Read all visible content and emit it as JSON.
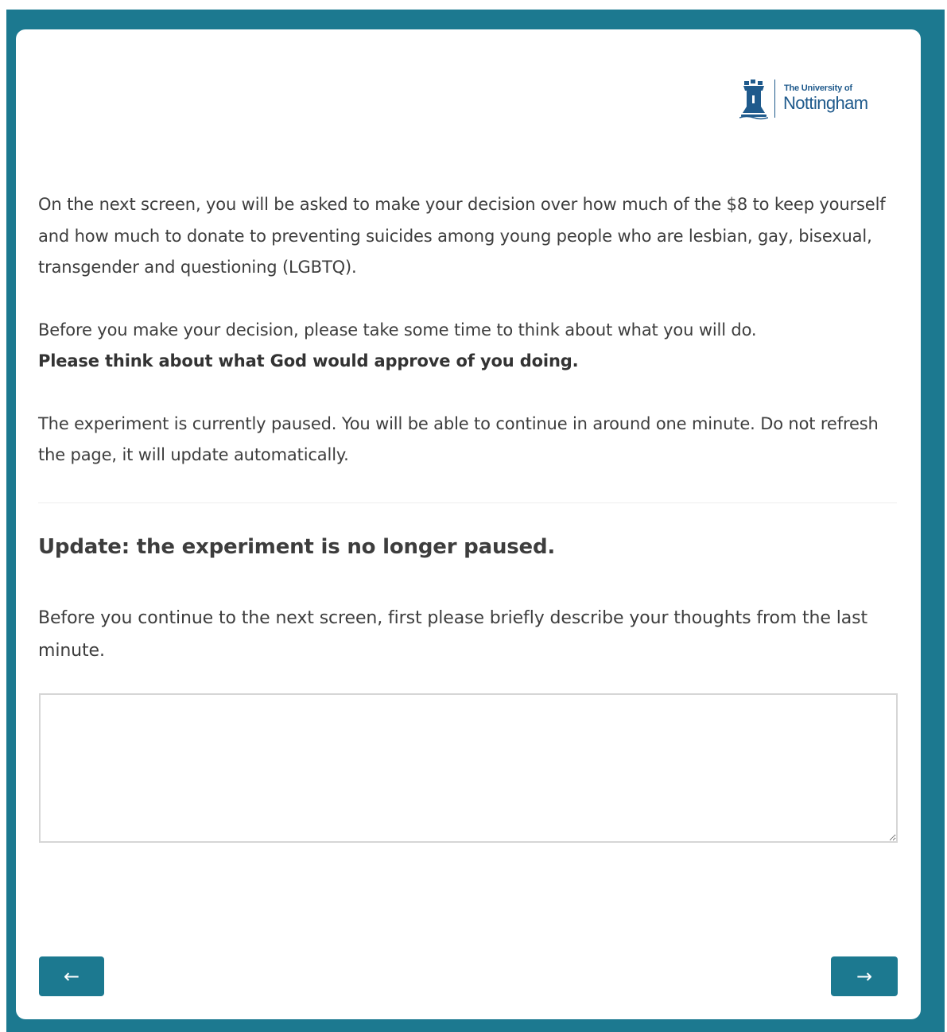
{
  "logo": {
    "line1": "The University of",
    "line2": "Nottingham",
    "brand_color": "#1f5a8c"
  },
  "intro": {
    "paragraph1": "On the next screen, you will be asked to make your decision over how much of the $8 to keep yourself and how much to donate to preventing suicides among young people who are lesbian, gay, bisexual, transgender and questioning (LGBTQ).",
    "paragraph2_plain": "Before you make your decision, please take some time to think about what you will do.",
    "paragraph2_bold": "Please think about what God would approve of you doing.",
    "paragraph3": "The experiment is currently paused. You will be able to continue in around one minute. Do not refresh the page, it will update automatically."
  },
  "update": {
    "heading": "Update: the experiment is no longer paused.",
    "prompt": "Before you continue to the next screen, first please briefly describe your thoughts from the last minute.",
    "textarea_value": ""
  },
  "nav": {
    "back_label": "←",
    "next_label": "→"
  },
  "colors": {
    "frame": "#1c7990",
    "button": "#1c7990",
    "text": "#3d3d3d"
  }
}
